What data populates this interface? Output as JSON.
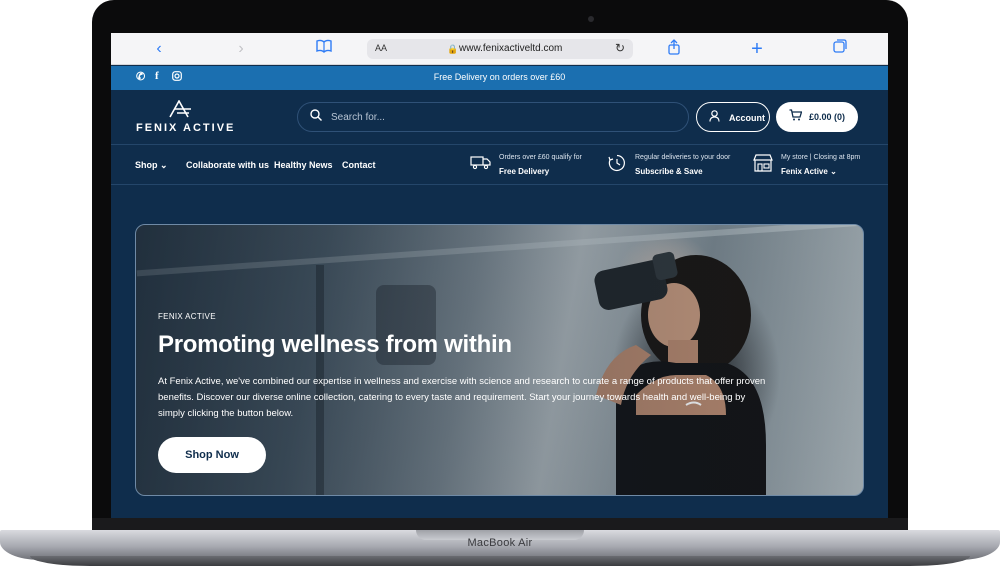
{
  "device": {
    "label": "MacBook Air"
  },
  "browser": {
    "text_size_label": "AA",
    "url": "www.fenixactiveltd.com"
  },
  "announcement": {
    "text": "Free Delivery on orders over £60"
  },
  "header": {
    "logo_text": "FENIX ACTIVE",
    "search_placeholder": "Search for...",
    "account_label": "Account",
    "cart_label": "£0.00 (0)"
  },
  "nav": {
    "items": [
      "Shop",
      "Collaborate with us",
      "Healthy News",
      "Contact"
    ]
  },
  "perks": [
    {
      "small": "Orders over £60 qualify for",
      "big": "Free Delivery",
      "icon": "truck-icon"
    },
    {
      "small": "Regular deliveries to your door",
      "big": "Subscribe & Save",
      "icon": "clock-icon"
    },
    {
      "small": "My store  |  Closing at 8pm",
      "big": "Fenix Active",
      "icon": "store-icon"
    }
  ],
  "hero": {
    "kicker": "FENIX ACTIVE",
    "title": "Promoting wellness from within",
    "description": "At Fenix Active, we've combined our expertise in wellness and exercise with science and research to curate a range of products that offer proven benefits. Discover our diverse online collection, catering to every taste and requirement. Start your journey towards health and well-being by simply clicking the button below.",
    "cta": "Shop Now"
  },
  "colors": {
    "page_bg": "#0f2d4c",
    "announce_bg": "#1b6fb0",
    "safari_accent": "#2f7cf6"
  }
}
